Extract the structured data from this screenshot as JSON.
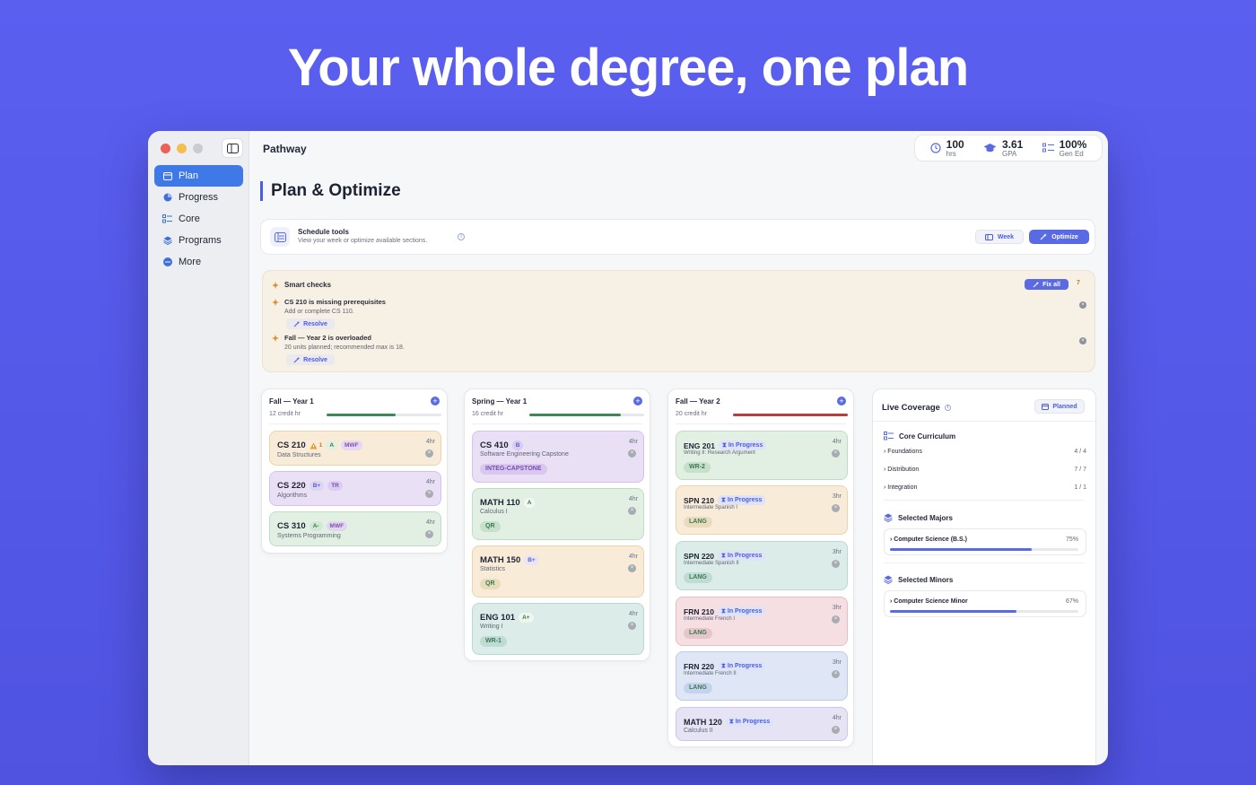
{
  "hero": {
    "title": "Your whole degree, one plan"
  },
  "app": {
    "title": "Pathway"
  },
  "sidebar": {
    "items": [
      {
        "label": "Plan",
        "icon": "calendar-icon",
        "active": true
      },
      {
        "label": "Progress",
        "icon": "pie-chart-icon",
        "active": false
      },
      {
        "label": "Core",
        "icon": "checklist-icon",
        "active": false
      },
      {
        "label": "Programs",
        "icon": "layers-icon",
        "active": false
      },
      {
        "label": "More",
        "icon": "more-icon",
        "active": false
      }
    ]
  },
  "stats": {
    "hours": {
      "value": "100",
      "label": "hrs"
    },
    "gpa": {
      "value": "3.61",
      "label": "GPA"
    },
    "gened": {
      "value": "100%",
      "label": "Gen Ed"
    }
  },
  "page": {
    "title": "Plan & Optimize"
  },
  "tools": {
    "title": "Schedule tools",
    "subtitle": "View your week or optimize available sections.",
    "week_label": "Week",
    "optimize_label": "Optimize"
  },
  "smart": {
    "title": "Smart checks",
    "fix_all_label": "Fix all",
    "count": "7",
    "issues": [
      {
        "title": "CS 210 is missing prerequisites",
        "desc": "Add or complete CS 110.",
        "action": "Resolve"
      },
      {
        "title": "Fall — Year 2 is overloaded",
        "desc": "20 units planned; recommended max is 18.",
        "action": "Resolve"
      }
    ]
  },
  "terms": [
    {
      "name": "Fall — Year 1",
      "credits": "12 credit hr",
      "load": 0.6,
      "bar_color": "#3b8a55",
      "courses": [
        {
          "code": "CS 210",
          "title": "Data Structures",
          "hrs": "4hr",
          "warn": "1",
          "grade": "A",
          "tags": [
            "MWF"
          ],
          "bottom_tag": "",
          "in_progress": false
        },
        {
          "code": "CS 220",
          "title": "Algorithms",
          "hrs": "4hr",
          "warn": "",
          "grade": "B+",
          "tags": [
            "TR"
          ],
          "bottom_tag": "",
          "in_progress": false
        },
        {
          "code": "CS 310",
          "title": "Systems Programming",
          "hrs": "4hr",
          "warn": "",
          "grade": "A-",
          "tags": [
            "MWF"
          ],
          "bottom_tag": "",
          "in_progress": false
        }
      ]
    },
    {
      "name": "Spring — Year 1",
      "credits": "16 credit hr",
      "load": 0.8,
      "bar_color": "#3b8a55",
      "courses": [
        {
          "code": "CS 410",
          "title": "Software Engineering Capstone",
          "hrs": "4hr",
          "grade": "B",
          "bottom_tag": "INTEG-CAPSTONE"
        },
        {
          "code": "MATH 110",
          "title": "Calculus I",
          "hrs": "4hr",
          "grade": "A",
          "bottom_tag": "QR"
        },
        {
          "code": "MATH 150",
          "title": "Statistics",
          "hrs": "4hr",
          "grade": "B+",
          "bottom_tag": "QR"
        },
        {
          "code": "ENG 101",
          "title": "Writing I",
          "hrs": "4hr",
          "grade": "A+",
          "bottom_tag": "WR-1"
        }
      ]
    },
    {
      "name": "Fall — Year 2",
      "credits": "20 credit hr",
      "load": 1.0,
      "bar_color": "#c0393f",
      "in_progress_label": "In Progress",
      "courses": [
        {
          "code": "ENG 201",
          "title": "Writing II: Research Argument",
          "hrs": "4hr",
          "bottom_tag": "WR-2"
        },
        {
          "code": "SPN 210",
          "title": "Intermediate Spanish I",
          "hrs": "3hr",
          "bottom_tag": "LANG"
        },
        {
          "code": "SPN 220",
          "title": "Intermediate Spanish II",
          "hrs": "3hr",
          "bottom_tag": "LANG"
        },
        {
          "code": "FRN 210",
          "title": "Intermediate French I",
          "hrs": "3hr",
          "bottom_tag": "LANG"
        },
        {
          "code": "FRN 220",
          "title": "Intermediate French II",
          "hrs": "3hr",
          "bottom_tag": "LANG"
        },
        {
          "code": "MATH 120",
          "title": "Calculus II",
          "hrs": "4hr",
          "bottom_tag": ""
        }
      ]
    }
  ],
  "coverage": {
    "title": "Live Coverage",
    "planned_label": "Planned",
    "core_title": "Core Curriculum",
    "core_rows": [
      {
        "label": "Foundations",
        "value": "4 / 4"
      },
      {
        "label": "Distribution",
        "value": "7 / 7"
      },
      {
        "label": "Integration",
        "value": "1 / 1"
      }
    ],
    "majors_title": "Selected Majors",
    "majors": [
      {
        "label": "Computer Science (B.S.)",
        "value": "75%",
        "pct": 0.75
      }
    ],
    "minors_title": "Selected Minors",
    "minors": [
      {
        "label": "Computer Science Minor",
        "value": "67%",
        "pct": 0.67
      }
    ]
  },
  "colors": {
    "accent": "#5a6ae3",
    "active_nav": "#3f79e8",
    "background_gradient_top": "#5b5ff0",
    "ok_bar": "#3b8a55",
    "over_bar": "#c0393f"
  }
}
